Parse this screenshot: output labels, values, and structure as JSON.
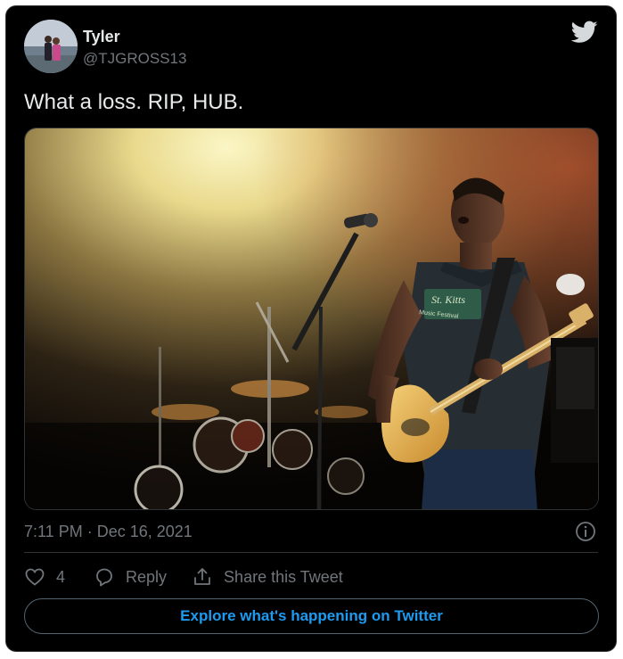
{
  "author": {
    "name": "Tyler",
    "handle": "@TJGROSS13"
  },
  "tweet": {
    "text": "What a loss. RIP, HUB.",
    "timestamp": "7:11 PM · Dec 16, 2021"
  },
  "media": {
    "shirt_text_1": "St. Kitts",
    "shirt_text_2": "Music Festival"
  },
  "actions": {
    "like_count": "4",
    "reply_label": "Reply",
    "share_label": "Share this Tweet"
  },
  "footer": {
    "explore_label": "Explore what's happening on Twitter"
  },
  "colors": {
    "background": "#000000",
    "accent": "#1d9bf0",
    "secondary_text": "#71767b"
  },
  "icons": [
    "twitter-bird-icon",
    "info-icon",
    "heart-icon",
    "reply-icon",
    "share-icon"
  ]
}
